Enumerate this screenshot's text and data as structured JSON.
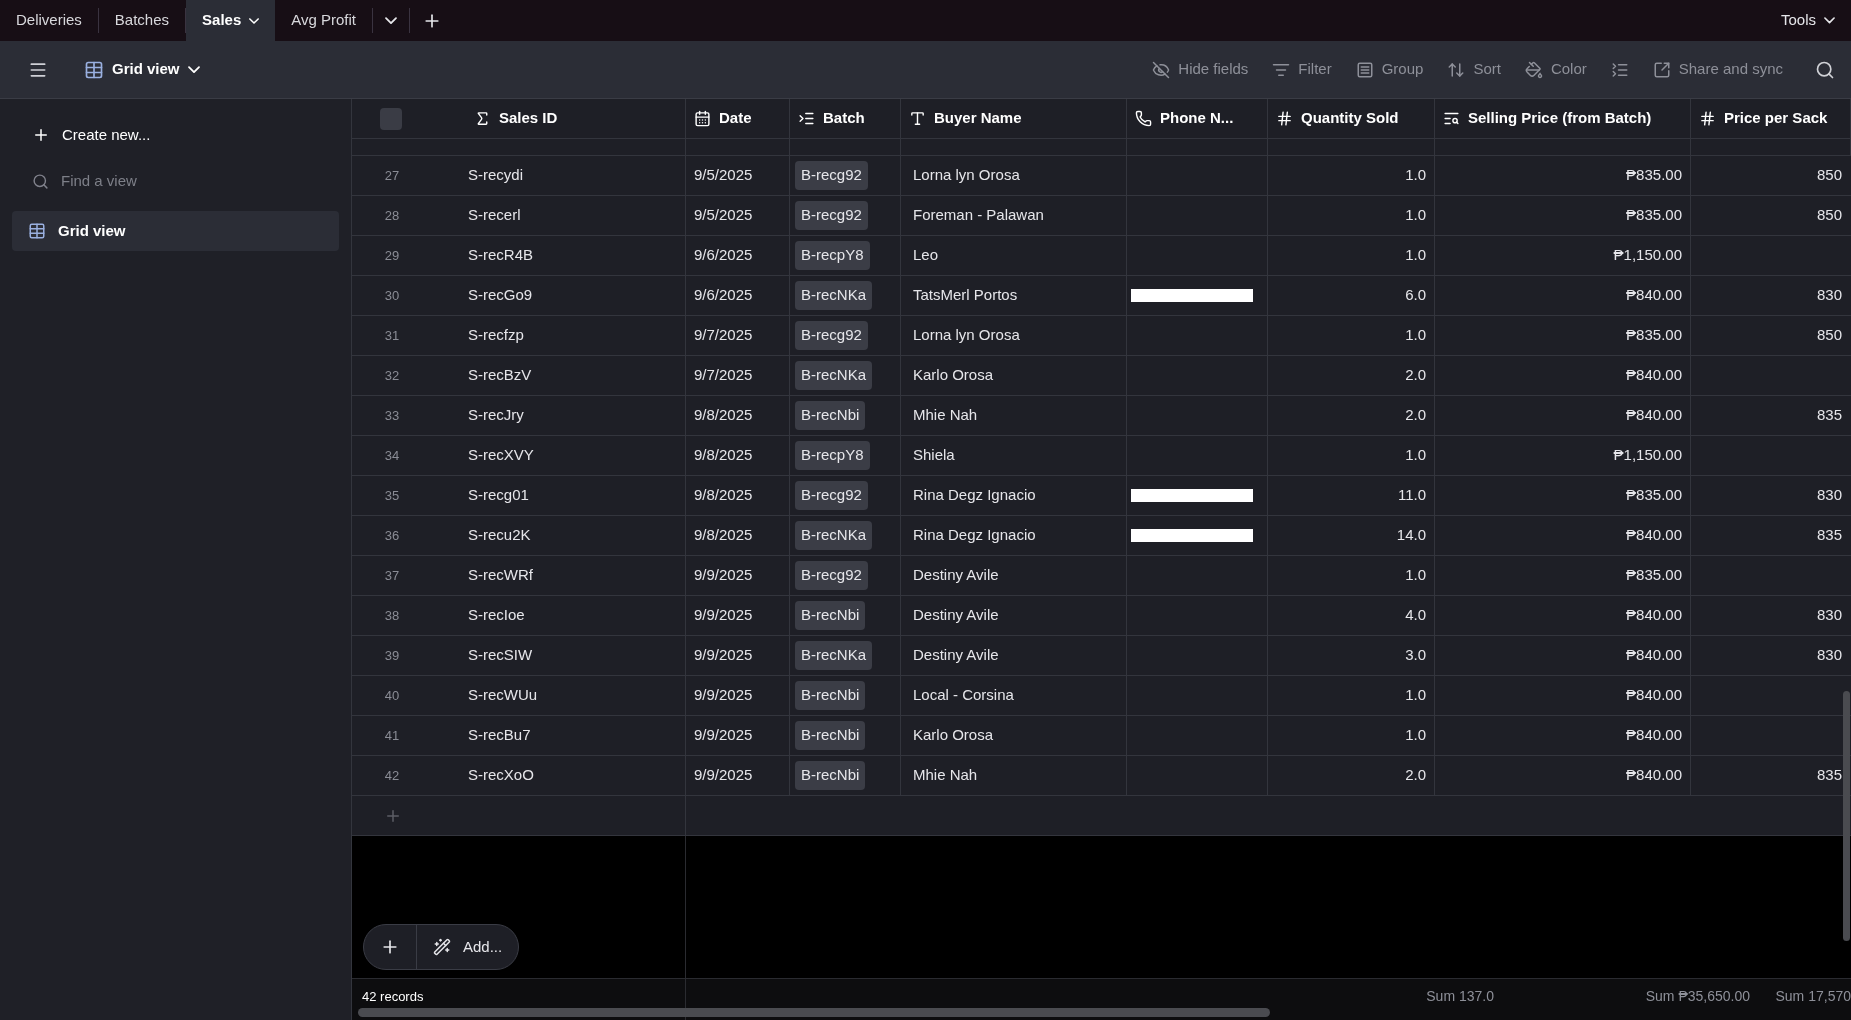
{
  "tabs": [
    {
      "label": "Deliveries",
      "selected": false
    },
    {
      "label": "Batches",
      "selected": false
    },
    {
      "label": "Sales",
      "selected": true
    },
    {
      "label": "Avg Profit",
      "selected": false
    }
  ],
  "tools": "Tools",
  "toolbar": {
    "view": "Grid view",
    "actions": [
      {
        "label": "Hide fields",
        "kind": "hide"
      },
      {
        "label": "Filter",
        "kind": "filter"
      },
      {
        "label": "Group",
        "kind": "group"
      },
      {
        "label": "Sort",
        "kind": "sort"
      },
      {
        "label": "Color",
        "kind": "color"
      },
      {
        "kind": "height"
      },
      {
        "label": "Share and sync",
        "kind": "share"
      }
    ]
  },
  "sidebar": {
    "create": "Create new...",
    "find_placeholder": "Find a view",
    "views": [
      {
        "label": "Grid view",
        "selected": true
      }
    ]
  },
  "select_all_checked": false,
  "columns": [
    {
      "label": "Sales ID",
      "kind": "formula"
    },
    {
      "label": "Date",
      "kind": "date"
    },
    {
      "label": "Batch",
      "kind": "link"
    },
    {
      "label": "Buyer Name",
      "kind": "text"
    },
    {
      "label": "Phone N...",
      "kind": "phone"
    },
    {
      "label": "Quantity Sold",
      "kind": "number"
    },
    {
      "label": "Selling Price (from Batch)",
      "kind": "lookup"
    },
    {
      "label": "Price per Sack",
      "kind": "number"
    }
  ],
  "rows": [
    {
      "n": "27",
      "id": "S-recydi",
      "date": "9/5/2025",
      "batch": "B-recg92",
      "buyer": "Lorna lyn Orosa",
      "phone_redacted": false,
      "qty": "1.0",
      "selling": "₱835.00",
      "price": "850"
    },
    {
      "n": "28",
      "id": "S-recerl",
      "date": "9/5/2025",
      "batch": "B-recg92",
      "buyer": "Foreman - Palawan",
      "phone_redacted": false,
      "qty": "1.0",
      "selling": "₱835.00",
      "price": "850"
    },
    {
      "n": "29",
      "id": "S-recR4B",
      "date": "9/6/2025",
      "batch": "B-recpY8",
      "buyer": "Leo",
      "phone_redacted": false,
      "qty": "1.0",
      "selling": "₱1,150.00"
    },
    {
      "n": "30",
      "id": "S-recGo9",
      "date": "9/6/2025",
      "batch": "B-recNKa",
      "buyer": "TatsMerl Portos",
      "phone_redacted": true,
      "qty": "6.0",
      "selling": "₱840.00",
      "price": "830"
    },
    {
      "n": "31",
      "id": "S-recfzp",
      "date": "9/7/2025",
      "batch": "B-recg92",
      "buyer": "Lorna lyn Orosa",
      "phone_redacted": false,
      "qty": "1.0",
      "selling": "₱835.00",
      "price": "850"
    },
    {
      "n": "32",
      "id": "S-recBzV",
      "date": "9/7/2025",
      "batch": "B-recNKa",
      "buyer": "Karlo Orosa",
      "phone_redacted": false,
      "qty": "2.0",
      "selling": "₱840.00"
    },
    {
      "n": "33",
      "id": "S-recJry",
      "date": "9/8/2025",
      "batch": "B-recNbi",
      "buyer": "Mhie Nah",
      "phone_redacted": false,
      "qty": "2.0",
      "selling": "₱840.00",
      "price": "835"
    },
    {
      "n": "34",
      "id": "S-recXVY",
      "date": "9/8/2025",
      "batch": "B-recpY8",
      "buyer": "Shiela",
      "phone_redacted": false,
      "qty": "1.0",
      "selling": "₱1,150.00"
    },
    {
      "n": "35",
      "id": "S-recg01",
      "date": "9/8/2025",
      "batch": "B-recg92",
      "buyer": "Rina Degz Ignacio",
      "phone_redacted": true,
      "qty": "11.0",
      "selling": "₱835.00",
      "price": "830"
    },
    {
      "n": "36",
      "id": "S-recu2K",
      "date": "9/8/2025",
      "batch": "B-recNKa",
      "buyer": "Rina Degz Ignacio",
      "phone_redacted": true,
      "qty": "14.0",
      "selling": "₱840.00",
      "price": "835"
    },
    {
      "n": "37",
      "id": "S-recWRf",
      "date": "9/9/2025",
      "batch": "B-recg92",
      "buyer": "Destiny Avile",
      "phone_redacted": false,
      "qty": "1.0",
      "selling": "₱835.00"
    },
    {
      "n": "38",
      "id": "S-recIoe",
      "date": "9/9/2025",
      "batch": "B-recNbi",
      "buyer": "Destiny Avile",
      "phone_redacted": false,
      "qty": "4.0",
      "selling": "₱840.00",
      "price": "830"
    },
    {
      "n": "39",
      "id": "S-recSIW",
      "date": "9/9/2025",
      "batch": "B-recNKa",
      "buyer": "Destiny Avile",
      "phone_redacted": false,
      "qty": "3.0",
      "selling": "₱840.00",
      "price": "830"
    },
    {
      "n": "40",
      "id": "S-recWUu",
      "date": "9/9/2025",
      "batch": "B-recNbi",
      "buyer": "Local - Corsina",
      "phone_redacted": false,
      "qty": "1.0",
      "selling": "₱840.00"
    },
    {
      "n": "41",
      "id": "S-recBu7",
      "date": "9/9/2025",
      "batch": "B-recNbi",
      "buyer": "Karlo Orosa",
      "phone_redacted": false,
      "qty": "1.0",
      "selling": "₱840.00"
    },
    {
      "n": "42",
      "id": "S-recXoO",
      "date": "9/9/2025",
      "batch": "B-recNbi",
      "buyer": "Mhie Nah",
      "phone_redacted": false,
      "qty": "2.0",
      "selling": "₱840.00",
      "price": "835"
    }
  ],
  "add_button": "Add...",
  "footer": {
    "records": "42 records",
    "sum_qty": "Sum 137.0",
    "sum_selling": "Sum ₱35,650.00",
    "sum_price": "Sum 17,570"
  }
}
